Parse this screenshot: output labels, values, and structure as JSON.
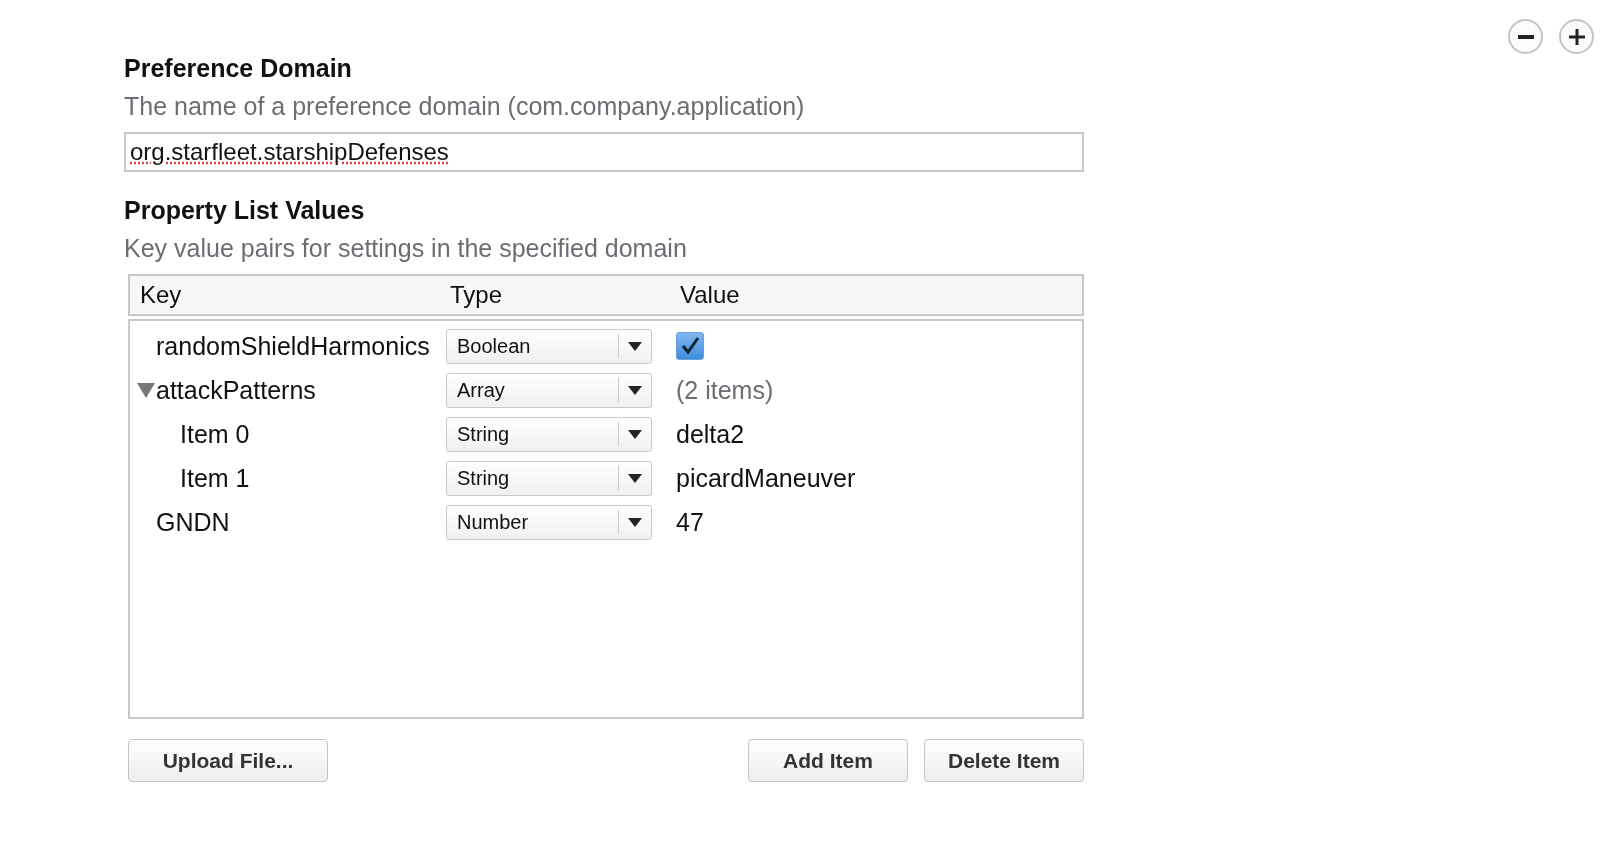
{
  "zoom_controls": [
    {
      "kind": "minus"
    },
    {
      "kind": "plus"
    }
  ],
  "preference_domain": {
    "title": "Preference Domain",
    "description": "The name of a preference domain (com.company.application)",
    "value": "org.starfleet.starshipDefenses"
  },
  "property_list": {
    "title": "Property List Values",
    "description": "Key value pairs for settings in the specified domain",
    "columns": [
      "Key",
      "Type",
      "Value"
    ],
    "rows": [
      {
        "key": "randomShieldHarmonics",
        "type": "Boolean",
        "kind": "checkbox",
        "checked": true
      },
      {
        "key": "attackPatterns",
        "type": "Array",
        "kind": "summary",
        "value": "(2 items)",
        "expanded": true,
        "children": [
          {
            "key": "Item 0",
            "type": "String",
            "kind": "text",
            "value": "delta2"
          },
          {
            "key": "Item 1",
            "type": "String",
            "kind": "text",
            "value": "picardManeuver"
          }
        ]
      },
      {
        "key": "GNDN",
        "type": "Number",
        "kind": "text",
        "value": "47"
      }
    ]
  },
  "buttons_left": [
    "Upload File..."
  ],
  "buttons_right": [
    "Add Item",
    "Delete Item"
  ]
}
